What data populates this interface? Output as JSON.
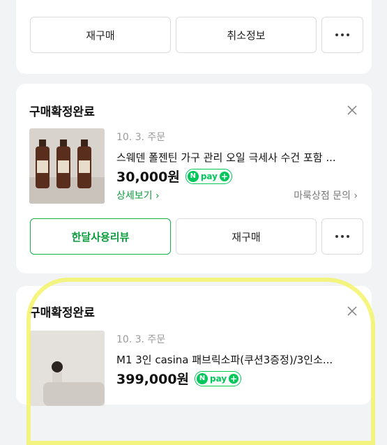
{
  "top_card": {
    "rebuy_label": "재구매",
    "cancel_info_label": "취소정보"
  },
  "orders": [
    {
      "status": "구매확정완료",
      "date": "10. 3. 주문",
      "product_name": "스웨덴 폴젠틴 가구 관리 오일 극세사 수건 포함 ...",
      "price": "30,000원",
      "detail_link": "상세보기",
      "store_inquiry": "마룩상점 문의",
      "review_label": "한달사용리뷰",
      "rebuy_label": "재구매"
    },
    {
      "status": "구매확정완료",
      "date": "10. 3. 주문",
      "product_name": "M1 3인 casina 패브릭소파(쿠션3증정)/3인소...",
      "price": "399,000원"
    }
  ],
  "npay": {
    "n": "N",
    "pay": "pay",
    "plus": "+"
  },
  "colors": {
    "green": "#03c75a",
    "highlight": "#f3f36a"
  }
}
